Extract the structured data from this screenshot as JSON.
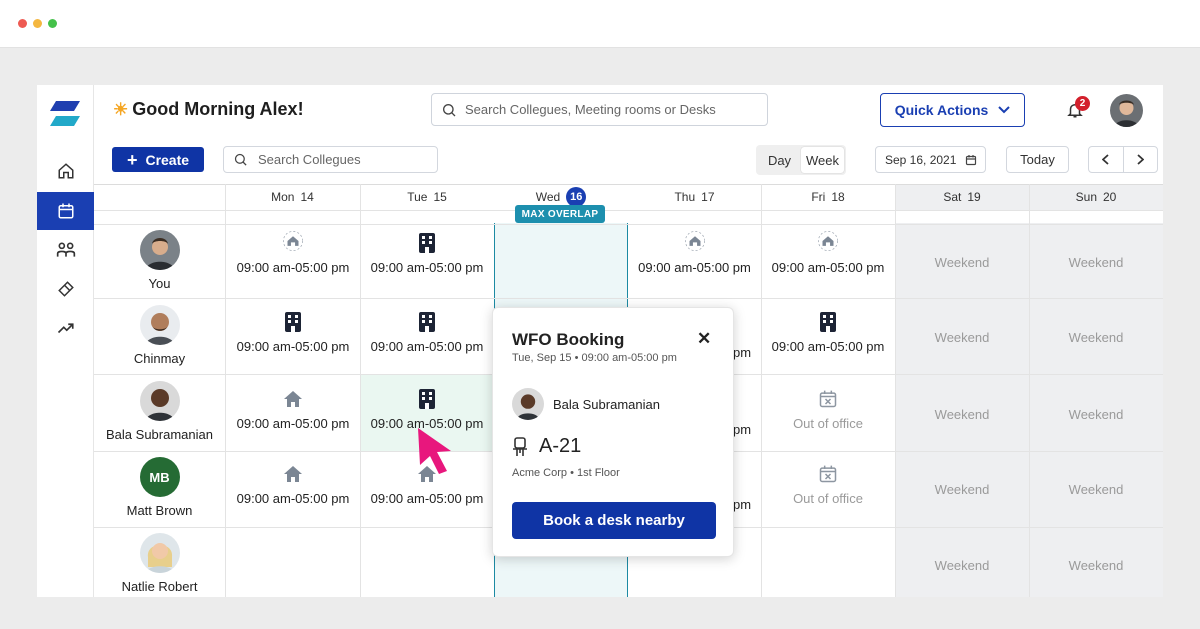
{
  "header": {
    "greeting_emoji": "☀",
    "greeting": "Good Morning Alex!",
    "search_placeholder": "Search Collegues, Meeting rooms or Desks",
    "quick_actions_label": "Quick Actions",
    "notification_count": "2"
  },
  "toolbar": {
    "create_label": "Create",
    "search_placeholder": "Search Collegues",
    "view_day": "Day",
    "view_week": "Week",
    "selected_view": "Week",
    "date_value": "Sep 16, 2021",
    "today_label": "Today"
  },
  "sidebar": {
    "items": [
      {
        "icon": "home-icon"
      },
      {
        "icon": "calendar-icon",
        "active": true
      },
      {
        "icon": "people-icon"
      },
      {
        "icon": "ticket-icon"
      },
      {
        "icon": "trending-icon"
      }
    ]
  },
  "calendar": {
    "days": [
      {
        "dow": "Mon",
        "num": "14"
      },
      {
        "dow": "Tue",
        "num": "15"
      },
      {
        "dow": "Wed",
        "num": "16",
        "today": true
      },
      {
        "dow": "Thu",
        "num": "17"
      },
      {
        "dow": "Fri",
        "num": "18"
      },
      {
        "dow": "Sat",
        "num": "19"
      },
      {
        "dow": "Sun",
        "num": "20"
      }
    ],
    "max_overlap_label": "MAX OVERLAP",
    "weekend_label": "Weekend",
    "ooo_label": "Out of office",
    "time_label": "09:00 am-05:00 pm",
    "people": [
      {
        "name": "You"
      },
      {
        "name": "Chinmay"
      },
      {
        "name": "Bala Subramanian"
      },
      {
        "name": "Matt Brown",
        "initials": "MB"
      },
      {
        "name": "Natlie Robert"
      }
    ]
  },
  "popup": {
    "title": "WFO Booking",
    "subtitle": "Tue, Sep 15 • 09:00 am-05:00 pm",
    "user_name": "Bala Subramanian",
    "desk": "A-21",
    "location": "Acme Corp • 1st Floor",
    "button_label": "Book a desk nearby"
  },
  "colors": {
    "brand": "#0f34a5",
    "accent_teal": "#1d8fae",
    "badge_red": "#d3202c",
    "pointer_pink": "#e8177d"
  }
}
